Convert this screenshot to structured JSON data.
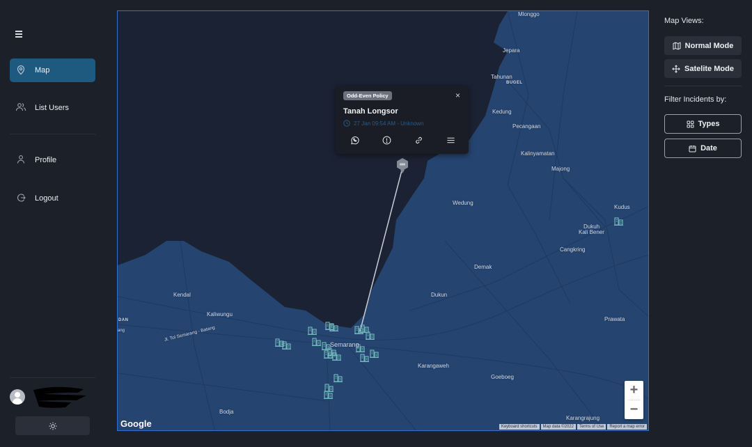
{
  "sidebar": {
    "menu_icon": "hamburger-icon",
    "items": [
      {
        "label": "Map",
        "icon": "map-pin-icon",
        "active": true
      },
      {
        "label": "List Users",
        "icon": "users-icon",
        "active": false
      },
      {
        "label": "Profile",
        "icon": "user-icon",
        "active": false
      },
      {
        "label": "Logout",
        "icon": "logout-icon",
        "active": false
      }
    ],
    "user": {
      "name": "[redacted]",
      "avatar_icon": "avatar-icon"
    },
    "theme_toggle_icon": "sun-icon"
  },
  "map": {
    "labels": [
      {
        "text": "Mlonggo"
      },
      {
        "text": "Jepara"
      },
      {
        "text": "Tahunan"
      },
      {
        "text": "BUGEL"
      },
      {
        "text": "Kedung"
      },
      {
        "text": "Pecangaan"
      },
      {
        "text": "Kalinyamatan"
      },
      {
        "text": "Majong"
      },
      {
        "text": "Wedung"
      },
      {
        "text": "Kudus"
      },
      {
        "text": "Dukuh"
      },
      {
        "text": "Kali Bener"
      },
      {
        "text": "Cangkring"
      },
      {
        "text": "Demak"
      },
      {
        "text": "Dukun"
      },
      {
        "text": "Prawata"
      },
      {
        "text": "Kendal"
      },
      {
        "text": "Kaliwungu"
      },
      {
        "text": "Jl. Tol Semarang - Batang"
      },
      {
        "text": "Semarang"
      },
      {
        "text": "Karangaweh"
      },
      {
        "text": "Goeboeg"
      },
      {
        "text": "Bodja"
      },
      {
        "text": "Karangrajung"
      },
      {
        "text": "DAN"
      },
      {
        "text": "ang"
      }
    ],
    "google_logo": "Google",
    "attribution": [
      "Keyboard shortcuts",
      "Map data ©2022",
      "Terms of Use",
      "Report a map error"
    ],
    "zoom_in": "+",
    "zoom_out": "−",
    "popup": {
      "badge": "Odd-Even Policy",
      "title": "Tanah Longsor",
      "time": "27 Jan 09:54 AM - Unknown",
      "close": "×",
      "actions": [
        "whatsapp-icon",
        "alert-icon",
        "link-icon",
        "menu-icon"
      ]
    }
  },
  "right_panel": {
    "map_views_title": "Map Views:",
    "normal_mode": "Normal Mode",
    "satelite_mode": "Satelite Mode",
    "filter_title": "Filter Incidents by:",
    "types": "Types",
    "date": "Date"
  },
  "colors": {
    "background": "#1c2029",
    "active_nav": "#1e5a80",
    "land": "#254470",
    "water": "#1b2233",
    "marker": "#6fb4b8",
    "map_border": "#2e6fd8"
  }
}
